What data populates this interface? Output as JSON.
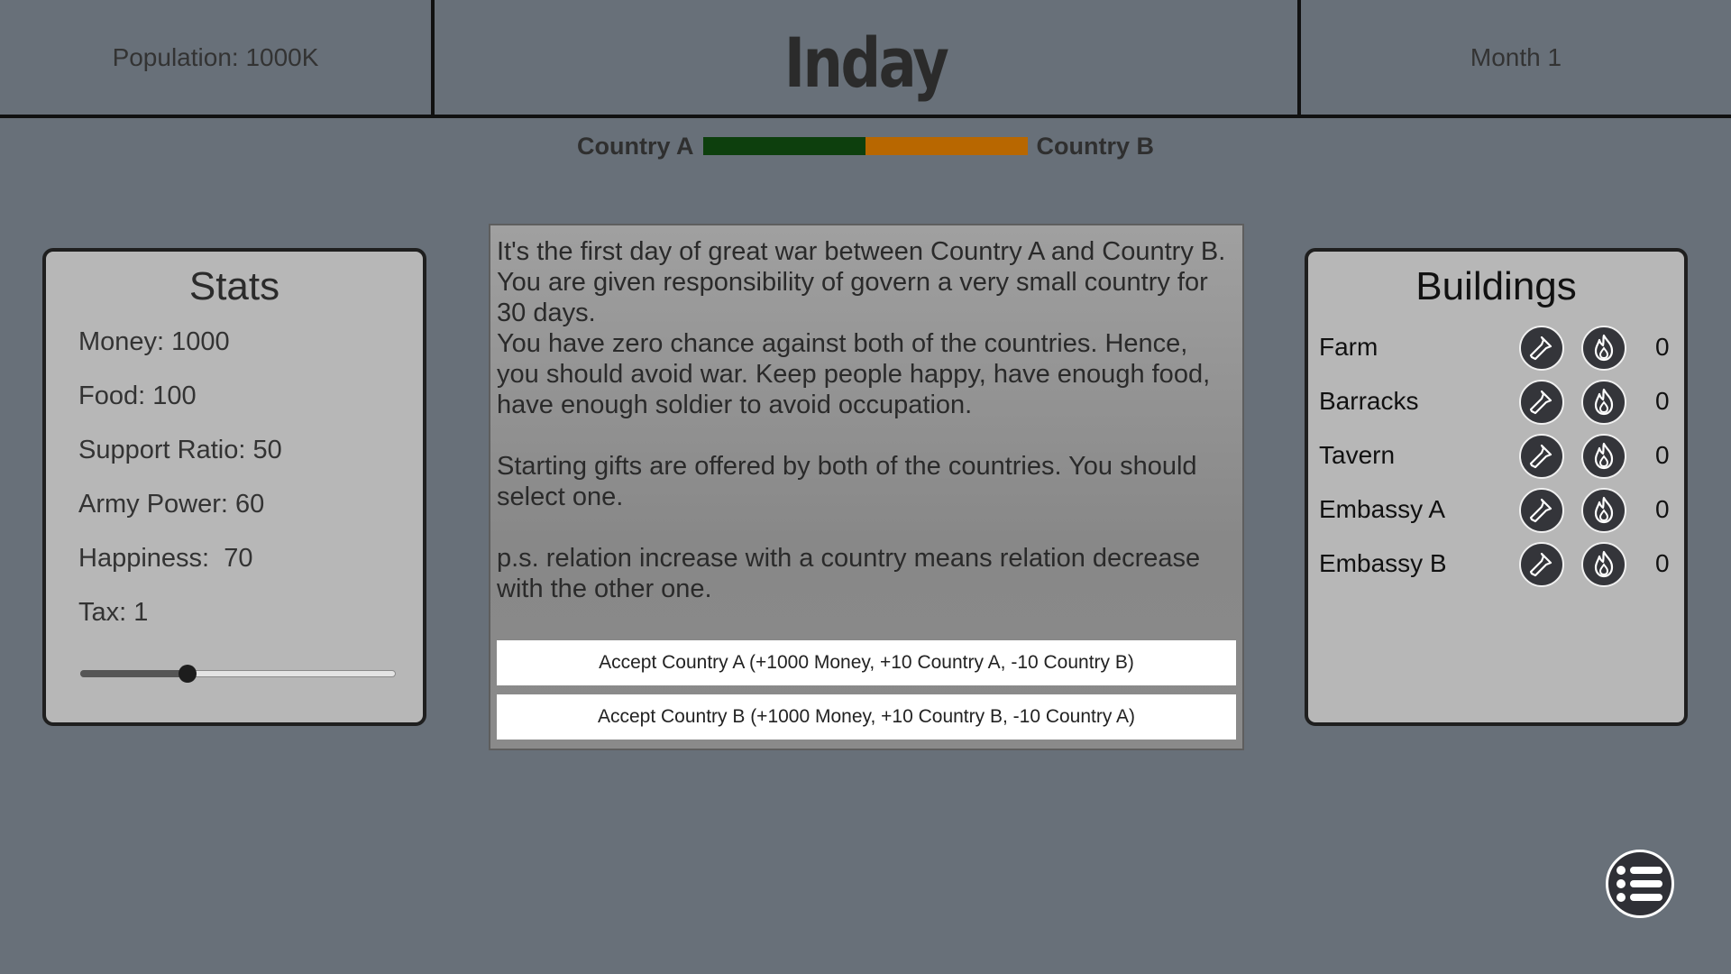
{
  "header": {
    "population": "Population: 1000K",
    "title": "Inday",
    "month": "Month 1"
  },
  "relation": {
    "left_label": "Country A",
    "right_label": "Country B",
    "country_a_share": 0.5,
    "colors": {
      "country_a": "#0d3f0d",
      "country_b": "#b86700"
    }
  },
  "stats": {
    "title": "Stats",
    "money": "Money: 1000",
    "food": "Food: 100",
    "support_ratio": "Support Ratio: 50",
    "army_power": "Army Power: 60",
    "happiness": "Happiness:  70",
    "tax": "Tax: 1",
    "tax_slider_fraction": 0.34
  },
  "story": {
    "paragraphs": [
      "It's the first day of great war between Country A and Country B. You are given responsibility of govern a very small country for 30 days.",
      "You have zero chance against both of the countries. Hence, you should avoid war. Keep people happy, have enough food, have enough soldier to avoid occupation.",
      "Starting gifts are offered by both of the countries. You should select one.",
      "p.s. relation increase with a country means relation decrease with the other one."
    ],
    "choice_a": "Accept Country A (+1000 Money, +10 Country A, -10 Country B)",
    "choice_b": "Accept Country B (+1000 Money, +10 Country B, -10 Country A)"
  },
  "buildings": {
    "title": "Buildings",
    "items": [
      {
        "name": "Farm",
        "count": "0"
      },
      {
        "name": "Barracks",
        "count": "0"
      },
      {
        "name": "Tavern",
        "count": "0"
      },
      {
        "name": "Embassy A",
        "count": "0"
      },
      {
        "name": "Embassy B",
        "count": "0"
      }
    ],
    "build_icon": "hammer-icon",
    "burn_icon": "fire-icon"
  },
  "menu": {
    "icon": "list-menu-icon"
  }
}
